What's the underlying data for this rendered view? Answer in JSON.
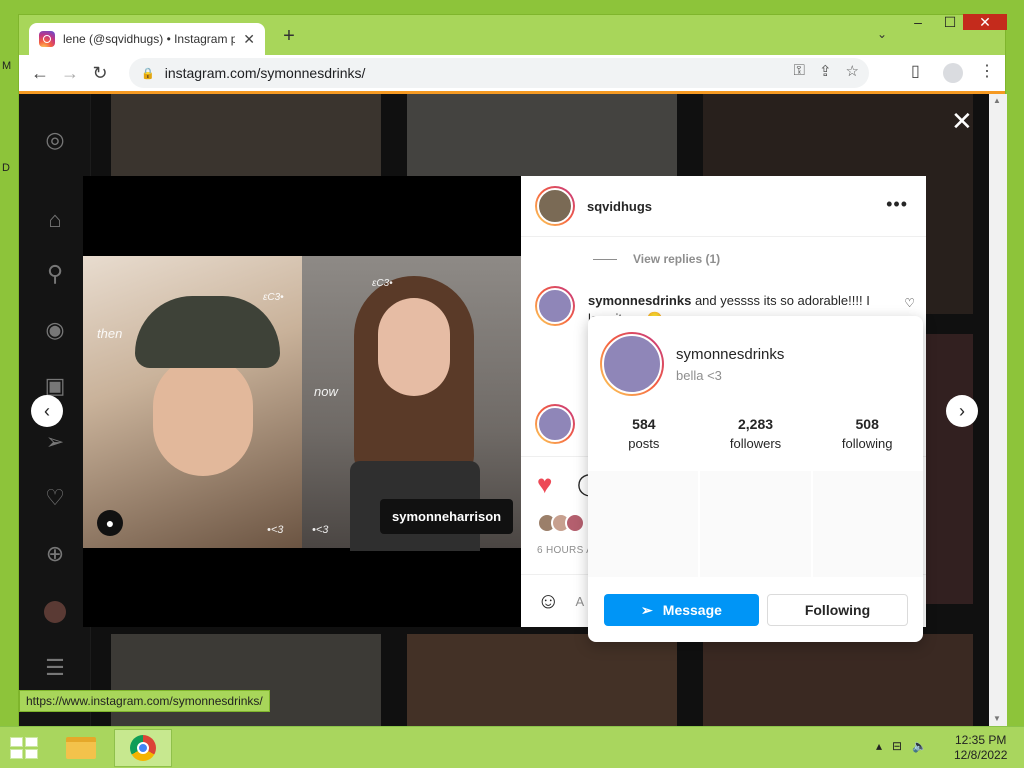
{
  "browser": {
    "tab_title": "lene (@sqvidhugs) • Instagram p",
    "url": "instagram.com/symonnesdrinks/",
    "status_url": "https://www.instagram.com/symonnesdrinks/"
  },
  "post": {
    "author": "sqvidhugs",
    "view_replies": "View replies (1)",
    "comment_user": "symonnesdrinks",
    "comment_text": " and yessss its so adorable!!!! I love it sm 😊",
    "time": "6 HOURS A",
    "add_comment_placeholder": "A",
    "tag": "symonneharrison",
    "photo_texts": {
      "then": "then",
      "now": "now",
      "deco1": "ɛС3•",
      "deco2": "ɛС3•",
      "deco3": "•<3",
      "deco4": "•<3"
    }
  },
  "profile_card": {
    "username": "symonnesdrinks",
    "bio": "bella <3",
    "stats": [
      {
        "value": "584",
        "label": "posts"
      },
      {
        "value": "2,283",
        "label": "followers"
      },
      {
        "value": "508",
        "label": "following"
      }
    ],
    "message_label": "Message",
    "following_label": "Following"
  },
  "taskbar": {
    "time": "12:35 PM",
    "date": "12/8/2022"
  },
  "colors": {
    "instagram_blue": "#0095f6",
    "like_red": "#ed4956",
    "desktop_green": "#8dc43a"
  }
}
